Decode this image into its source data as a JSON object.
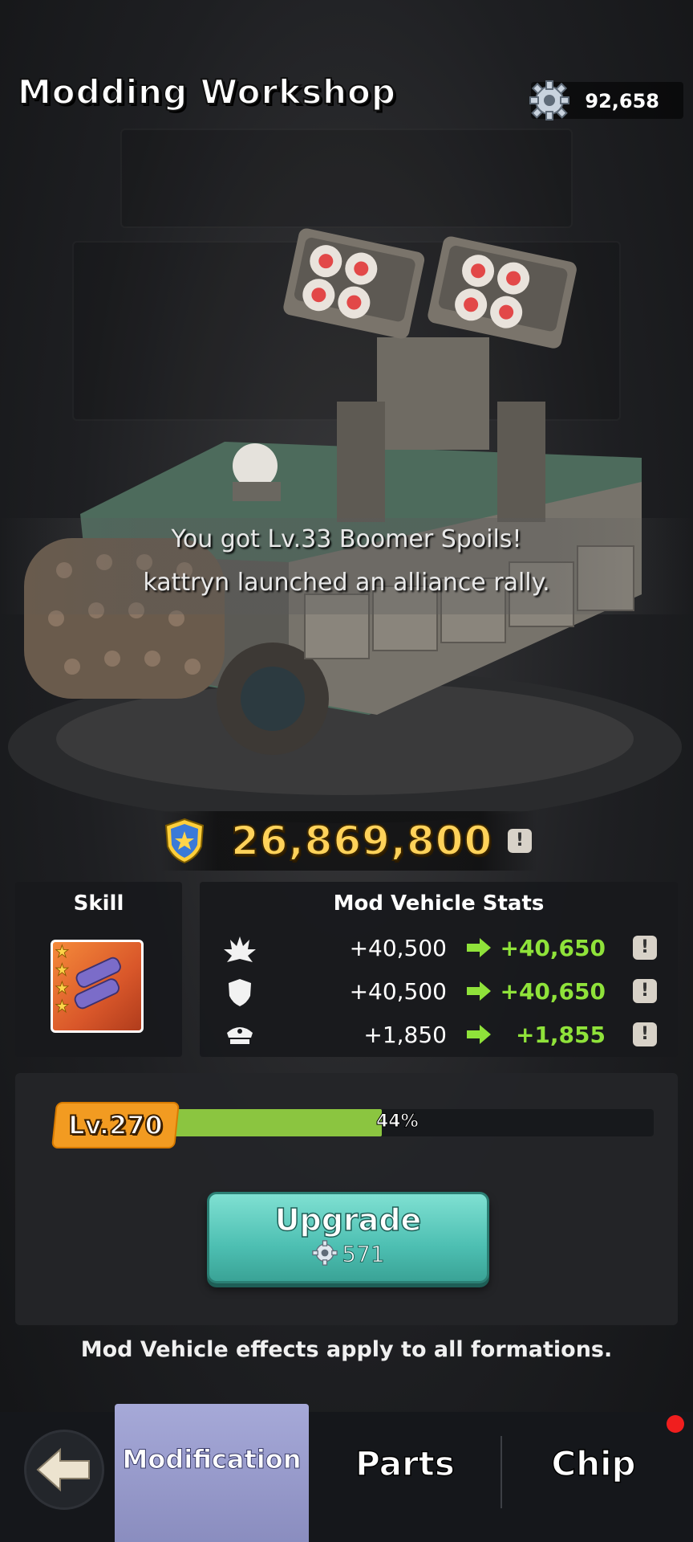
{
  "header": {
    "title": "Modding Workshop",
    "currency_icon": "gear-icon",
    "currency_value": "92,658"
  },
  "notification": {
    "line1": "You got Lv.33 Boomer Spoils!",
    "line2": "kattryn launched an alliance rally."
  },
  "power": {
    "icon": "shield-star-icon",
    "value": "26,869,800",
    "info_label": "!"
  },
  "skill": {
    "header": "Skill",
    "icon": "rocket-skill-icon",
    "stars": 4
  },
  "stats": {
    "header": "Mod Vehicle Stats",
    "rows": [
      {
        "icon": "attack-icon",
        "current": "+40,500",
        "next": "+40,650",
        "info_label": "!"
      },
      {
        "icon": "defense-icon",
        "current": "+40,500",
        "next": "+40,650",
        "info_label": "!"
      },
      {
        "icon": "officer-cap-icon",
        "current": "+1,850",
        "next": "+1,855",
        "info_label": "!"
      }
    ]
  },
  "level": {
    "label": "Lv.270",
    "progress_percent": 44,
    "progress_text": "44%"
  },
  "upgrade": {
    "label": "Upgrade",
    "cost": "571",
    "cost_icon": "gear-icon"
  },
  "footer_note": "Mod Vehicle effects apply to all formations.",
  "nav": {
    "back_icon": "back-arrow-icon",
    "tabs": [
      {
        "label": "Modification",
        "active": true
      },
      {
        "label": "Parts",
        "active": false
      },
      {
        "label": "Chip",
        "active": false,
        "badge": true
      }
    ]
  },
  "colors": {
    "accent_green": "#8fe23a",
    "power_gold": "#ffd25a",
    "upgrade_teal": "#4dbfb2",
    "level_orange": "#f29b21"
  }
}
